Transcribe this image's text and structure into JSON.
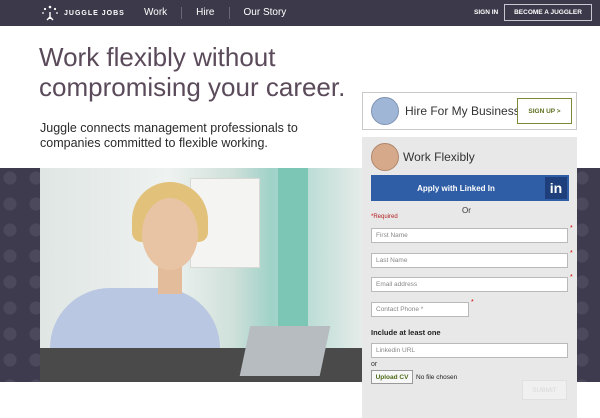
{
  "header": {
    "logo_text": "JUGGLE JOBS",
    "nav": [
      "Work",
      "Hire",
      "Our Story"
    ],
    "sign_in": "SIGN IN",
    "become": "BECOME A JUGGLER"
  },
  "hero": {
    "title": "Work flexibly without compromising your career.",
    "subtitle": "Juggle connects management professionals to companies committed to flexible working."
  },
  "hire_card": {
    "title": "Hire For My Business",
    "button": "SIGN UP >"
  },
  "form": {
    "title": "Work Flexibly",
    "linkedin": "Apply with Linked In",
    "linkedin_icon": "in",
    "or": "Or",
    "required_label": "Required",
    "fields": {
      "first_name": "First Name",
      "last_name": "Last Name",
      "email": "Email address",
      "phone": "Contact Phone *",
      "linkedin_url": "Linkedin URL"
    },
    "include": "Include at least one",
    "or_small": "or",
    "upload": "Upload CV",
    "no_file": "No file chosen",
    "submit": "SUBMIT"
  },
  "colors": {
    "topbar": "#3c3a4a",
    "brand_green": "#5b6d1e",
    "linkedin_blue": "#2f5ea6"
  }
}
